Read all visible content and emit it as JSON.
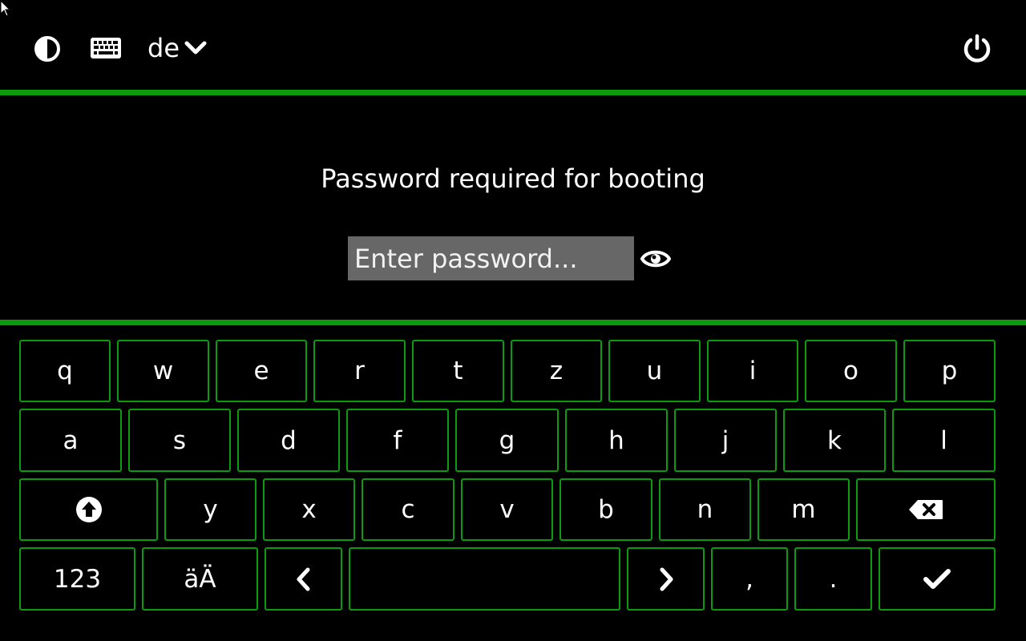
{
  "topbar": {
    "contrast_icon": "contrast-icon",
    "keyboard_icon": "keyboard-icon",
    "language": "de",
    "language_dropdown_icon": "chevron-down-icon",
    "power_icon": "power-icon"
  },
  "colors": {
    "accent": "#0c9b0c",
    "background": "#000000",
    "input_bg": "#676767",
    "text": "#ffffff"
  },
  "prompt": {
    "title": "Password required for booting",
    "placeholder": "Enter password...",
    "reveal_icon": "eye-icon"
  },
  "keyboard": {
    "row1": [
      "q",
      "w",
      "e",
      "r",
      "t",
      "z",
      "u",
      "i",
      "o",
      "p"
    ],
    "row2": [
      "a",
      "s",
      "d",
      "f",
      "g",
      "h",
      "j",
      "k",
      "l"
    ],
    "row3": {
      "shift_icon": "shift-icon",
      "letters": [
        "y",
        "x",
        "c",
        "v",
        "b",
        "n",
        "m"
      ],
      "backspace_icon": "backspace-icon"
    },
    "row4": {
      "numbers": "123",
      "umlaut": "äÄ",
      "left_icon": "chevron-left-icon",
      "space": "",
      "right_icon": "chevron-right-icon",
      "comma": ",",
      "period": ".",
      "enter_icon": "checkmark-icon"
    }
  }
}
